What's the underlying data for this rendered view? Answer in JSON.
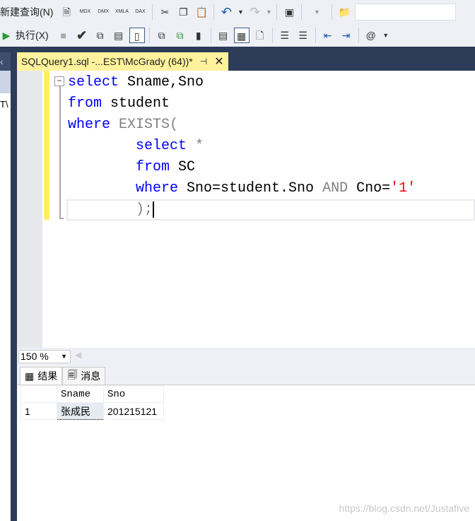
{
  "toolbar1": {
    "new_query": "新建查询(N)",
    "icons": [
      "new-file-icon",
      "mdx-icon",
      "dmx-icon",
      "xmla-icon",
      "dax-icon",
      "cut-icon",
      "copy-icon",
      "paste-icon",
      "undo-icon",
      "redo-icon",
      "activity-monitor-icon",
      "find-folder-icon"
    ],
    "mdx": "MDX",
    "dmx": "DMX",
    "xmla": "XMLA",
    "dax": "DAX"
  },
  "toolbar2": {
    "execute": "执行(X)"
  },
  "tab": {
    "title": "SQLQuery1.sql -...EST\\McGrady (64))*"
  },
  "leftpanel": {
    "text": "T\\"
  },
  "code": {
    "l1a": "select",
    "l1b": " Sname,Sno",
    "l2a": "from",
    "l2b": " student",
    "l3a": "where",
    "l3b": " EXISTS(",
    "l4a": "select",
    "l4b": " *",
    "l5a": "from",
    "l5b": " SC",
    "l6a": "where",
    "l6b": " Sno=student.Sno ",
    "l6c": "AND",
    "l6d": " Cno=",
    "l6e": "'1'",
    "l7": ");"
  },
  "zoom": {
    "value": "150 %"
  },
  "results": {
    "tabs": [
      "结果",
      "消息"
    ],
    "columns": [
      "Sname",
      "Sno"
    ],
    "rows": [
      {
        "num": "1",
        "Sname": "张成民",
        "Sno": "201215121"
      }
    ]
  },
  "watermark": "https://blog.csdn.net/Justafive"
}
